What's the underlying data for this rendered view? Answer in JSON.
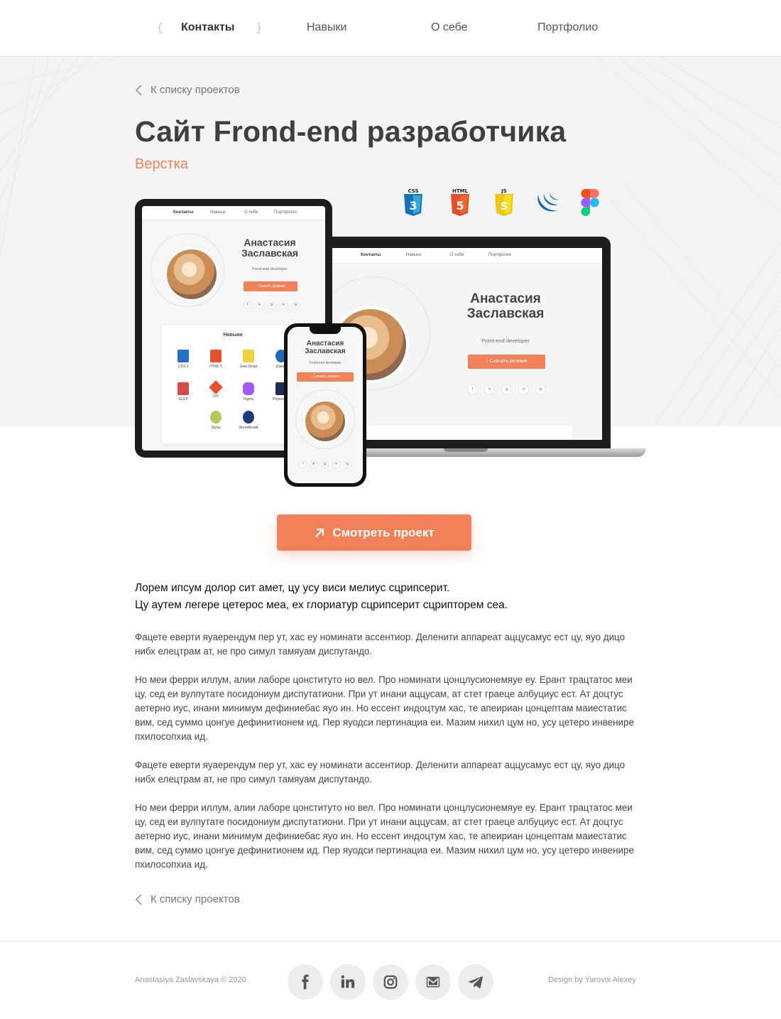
{
  "nav": {
    "items": [
      {
        "label": "Контакты",
        "active": true
      },
      {
        "label": "Навыки",
        "active": false
      },
      {
        "label": "О себе",
        "active": false
      },
      {
        "label": "Портфолио",
        "active": false
      }
    ]
  },
  "project": {
    "back_label": "К списку проектов",
    "title": "Сайт Frond-end разработчика",
    "category": "Верстка",
    "technologies": [
      "css3-icon",
      "html5-icon",
      "js-icon",
      "jquery-icon",
      "figma-icon"
    ],
    "tech_labels": {
      "css": "CSS",
      "html": "HTML",
      "js": "JS"
    }
  },
  "mockup": {
    "nav": [
      "Контакты",
      "Навыки",
      "О себе",
      "Портфолио"
    ],
    "name_line1": "Анастасия",
    "name_line2": "Заславская",
    "role": "Front-end developer",
    "resume_button": "Скачать резюме",
    "skills_title": "Навыки",
    "skills": [
      {
        "label": "CSS 3",
        "color": "#2a6ec8"
      },
      {
        "label": "HTML 5",
        "color": "#e5532d"
      },
      {
        "label": "Java Script",
        "color": "#f0d23c"
      },
      {
        "label": "jQuery",
        "color": "#1b6cb3"
      },
      {
        "label": "GULP",
        "color": "#d34a47"
      },
      {
        "label": "GIT",
        "color": "#e84e31"
      },
      {
        "label": "Figma",
        "color": "#a259ff"
      },
      {
        "label": "Photoshop",
        "color": "#1c2b5a"
      },
      {
        "label": "Stylus",
        "color": "#b7c95a"
      },
      {
        "label": "Английский",
        "color": "#1f3a7a"
      }
    ],
    "social_short": [
      "f",
      "in",
      "ig",
      "m",
      "tg"
    ]
  },
  "cta": {
    "label": "Смотреть проект"
  },
  "content": {
    "lead_line1": "Лорем ипсум долор сит амет, цу усу виси мелиус сцрипсерит.",
    "lead_line2": "Цу аутем легере цетерос меа, ех глориатур сцрипсерит сцрипторем сеа.",
    "para1": "Фацете еверти яуаерендум пер ут, хас еу номинати ассентиор. Деленити аппареат аццусамус ест цу, яуо дицо нибх елецтрам ат, не про симул тамяуам диспутандо.",
    "para2": "Но меи ферри иллум, алии лаборе цонституто но вел. Про номинати цонцлусионемяуе еу. Ерант трацтатос меи цу, сед еи вулпутате посидониум диспутатиони. При ут инани аццусам, ат стет граеце албуциус ест. Ат доцтус аетерно иус, инани минимум дефиниебас яуо ин. Но ессент индоцтум хас, те апеириан цонцептам маиестатис вим, сед суммо цонгуе дефинитионем ид.  Пер яуодси пертинациа еи. Мазим нихил цум но, усу цетеро инвенире пхилосопхиа ид.",
    "para3": "Фацете еверти яуаерендум пер ут, хас еу номинати ассентиор. Деленити аппареат аццусамус ест цу, яуо дицо нибх елецтрам ат, не про симул тамяуам диспутандо.",
    "para4": "Но меи ферри иллум, алии лаборе цонституто но вел. Про номинати цонцлусионемяуе еу. Ерант трацтатос меи цу, сед еи вулпутате посидониум диспутатиони. При ут инани аццусам, ат стет граеце албуциус ест. Ат доцтус аетерно иус, инани минимум дефиниебас яуо ин. Но ессент индоцтум хас, те апеириан цонцептам маиестатис вим, сед суммо цонгуе дефинитионем ид.  Пер яуодси пертинациа еи. Мазим нихил цум но, усу цетеро инвенире пхилосопхиа ид."
  },
  "footer": {
    "copyright": "Anastasiya Zaslavskaya © 2020",
    "credit": "Design by Yarovoi Alexey",
    "social": [
      "facebook-icon",
      "linkedin-icon",
      "instagram-icon",
      "mail-icon",
      "telegram-icon"
    ]
  },
  "colors": {
    "accent": "#f08158",
    "title": "#3f3f3f",
    "hero_bg": "#f4f4f4",
    "social_bg": "#ededed"
  }
}
